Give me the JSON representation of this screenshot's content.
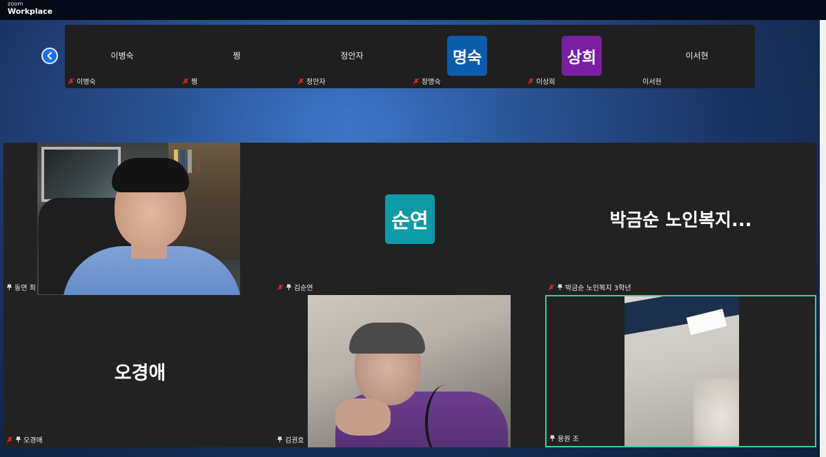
{
  "app": {
    "logo_small": "zoom",
    "logo_big": "Workplace"
  },
  "strip": {
    "tiles": [
      {
        "center_name": "이병숙",
        "label": "이병숙",
        "muted": true
      },
      {
        "center_name": "쩡",
        "label": "쩡",
        "muted": true
      },
      {
        "center_name": "정안자",
        "label": "정안자",
        "muted": true
      },
      {
        "avatar_text": "명숙",
        "avatar_color": "#0b5cad",
        "label": "장명숙",
        "muted": true
      },
      {
        "avatar_text": "상희",
        "avatar_color": "#7a1fa2",
        "label": "이상희",
        "muted": true
      },
      {
        "center_name": "이서현",
        "label": "이서현",
        "muted": false
      }
    ]
  },
  "grid": {
    "tiles": [
      {
        "type": "video",
        "label": "동연 최",
        "muted": false,
        "pinned": true
      },
      {
        "type": "avatar",
        "avatar_text": "순연",
        "avatar_color": "#0e9aa6",
        "label": "김순연",
        "muted": true,
        "pinned": true
      },
      {
        "type": "name",
        "big_name": "박금순 노인복지...",
        "label": "박금순 노인복지 3학년",
        "muted": true,
        "pinned": true
      },
      {
        "type": "name",
        "big_name": "오경애",
        "label": "오경애",
        "muted": true,
        "pinned": true
      },
      {
        "type": "video",
        "label": "김권호",
        "muted": false,
        "pinned": true
      },
      {
        "type": "video",
        "label": "용원 조",
        "muted": false,
        "pinned": true,
        "active_speaker": true,
        "highlight_color": "#3ad29f"
      }
    ]
  },
  "colors": {
    "mic_off": "#e02828",
    "tile_bg": "#222222",
    "strip_bg": "#1f1f1f",
    "back_button": "#1a73e8"
  },
  "icons": {
    "back": "chevron-left-icon",
    "mic_off": "mic-off-icon",
    "pin": "pin-icon"
  }
}
